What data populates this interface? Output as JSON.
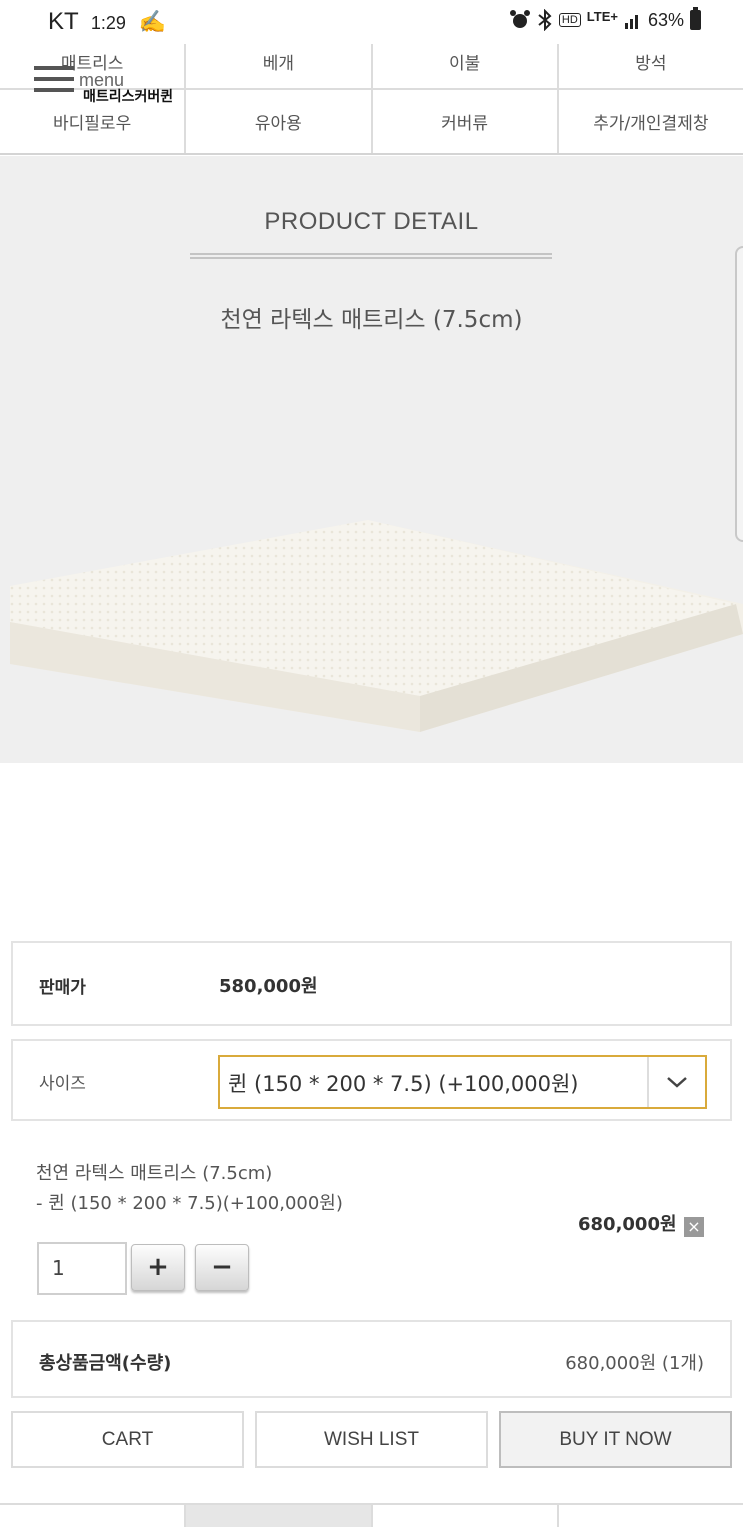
{
  "status_bar": {
    "carrier": "KT",
    "time": "1:29",
    "network": "LTE+",
    "hd": "HD",
    "battery": "63%"
  },
  "category_nav": {
    "row1": [
      "매트리스",
      "베개",
      "이불",
      "방석"
    ],
    "row2": [
      "바디필로우",
      "유아용",
      "커버류",
      "추가/개인결제창"
    ]
  },
  "menu": {
    "label": "menu",
    "shop_name": "매트리스커버퀸"
  },
  "product": {
    "section_title": "PRODUCT DETAIL",
    "name": "천연 라텍스 매트리스 (7.5cm)"
  },
  "price": {
    "label": "판매가",
    "value": "580,000원"
  },
  "size": {
    "label": "사이즈",
    "selected": "퀸 (150 * 200 * 7.5) (+100,000원)"
  },
  "selected_option": {
    "name": "천연 라텍스 매트리스 (7.5cm)",
    "detail": "- 퀸 (150 * 200 * 7.5)(+100,000원)",
    "price": "680,000원",
    "quantity": "1",
    "plus_label": "+",
    "minus_label": "−"
  },
  "total": {
    "label": "총상품금액(수량)",
    "value": "680,000원 (1개)"
  },
  "actions": {
    "cart": "CART",
    "wish_list": "WISH LIST",
    "buy_now": "BUY IT NOW"
  },
  "icons": {
    "alarm": "alarm-icon",
    "bluetooth": "bluetooth-icon",
    "signal": "signal-icon",
    "battery": "battery-icon",
    "menu": "hamburger-icon",
    "dropdown": "chevron-down-icon",
    "remove": "close-icon"
  },
  "colors": {
    "select_border": "#d9aa3b",
    "product_bg": "#efefef"
  }
}
